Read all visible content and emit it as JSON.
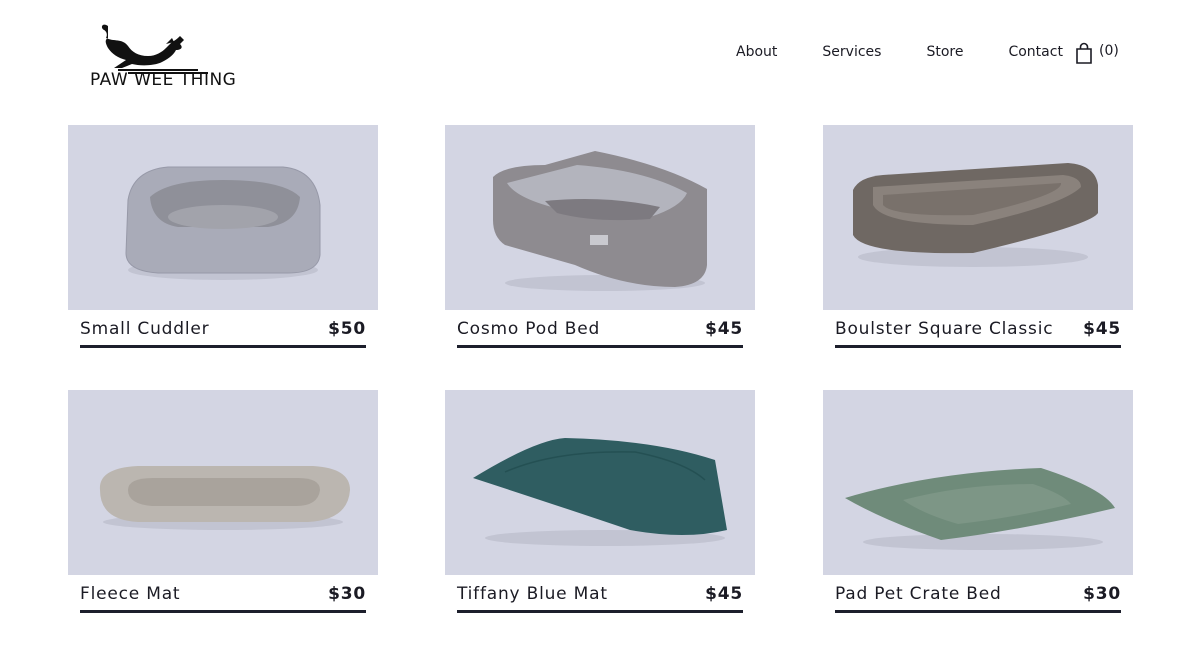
{
  "brand": {
    "name": "PAW WEE THING"
  },
  "nav": {
    "items": [
      "About",
      "Services",
      "Store",
      "Contact"
    ],
    "cart_count": "(0)"
  },
  "products": [
    {
      "name": "Small Cuddler",
      "price": "$50"
    },
    {
      "name": "Cosmo Pod Bed",
      "price": "$45"
    },
    {
      "name": "Boulster Square Classic",
      "price": "$45"
    },
    {
      "name": "Fleece Mat",
      "price": "$30"
    },
    {
      "name": "Tiffany Blue Mat",
      "price": "$45"
    },
    {
      "name": "Pad Pet Crate Bed",
      "price": "$30"
    }
  ],
  "colors": {
    "image_background": "#d3d5e3",
    "text": "#1b1b24",
    "underline": "#1d1f2c"
  },
  "icons": [
    "dog-logo-icon",
    "shopping-bag-icon"
  ]
}
